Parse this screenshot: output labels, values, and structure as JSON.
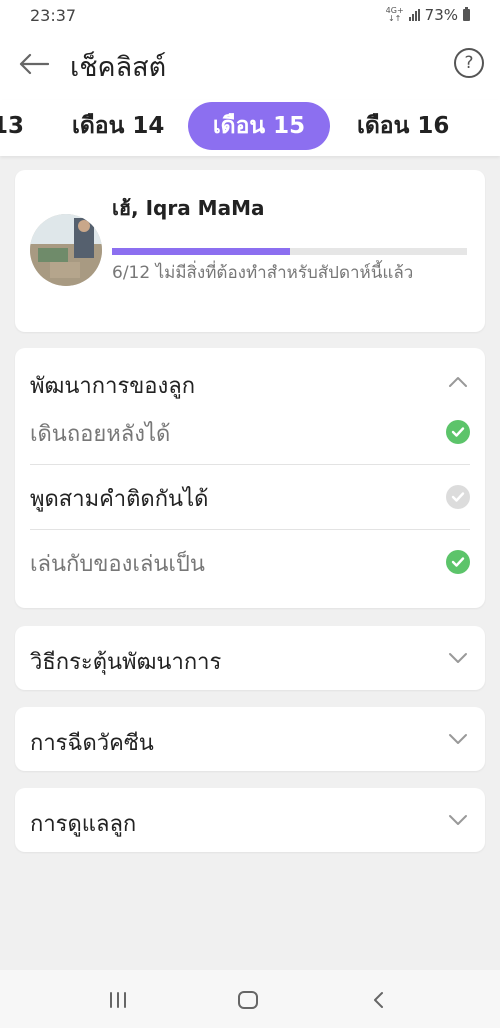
{
  "status": {
    "time": "23:37",
    "network": "4G+",
    "battery": "73%"
  },
  "header": {
    "title": "เช็คลิสต์",
    "help": "?"
  },
  "tabs": [
    {
      "label": "13",
      "active": false
    },
    {
      "label": "เดือน 14",
      "active": false
    },
    {
      "label": "เดือน 15",
      "active": true
    },
    {
      "label": "เดือน 16",
      "active": false
    }
  ],
  "profile": {
    "greeting": "เฮ้, Iqra MaMa",
    "progress_text": "6/12 ไม่มีสิ่งที่ต้องทำสำหรับสัปดาห์นี้แล้ว",
    "progress_fraction": 0.5
  },
  "development": {
    "title": "พัฒนาการของลูก",
    "items": [
      {
        "label": "เดินถอยหลังได้",
        "done": true
      },
      {
        "label": "พูดสามคำติดกันได้",
        "done": false
      },
      {
        "label": "เล่นกับของเล่นเป็น",
        "done": true
      }
    ]
  },
  "sections": [
    {
      "title": "วิธีกระตุ้นพัฒนาการ"
    },
    {
      "title": "การฉีดวัคซีน"
    },
    {
      "title": "การดูแลลูก"
    }
  ],
  "colors": {
    "accent": "#8c6ff0",
    "check_done": "#5cc46a",
    "check_pending": "#dcdcdc"
  }
}
